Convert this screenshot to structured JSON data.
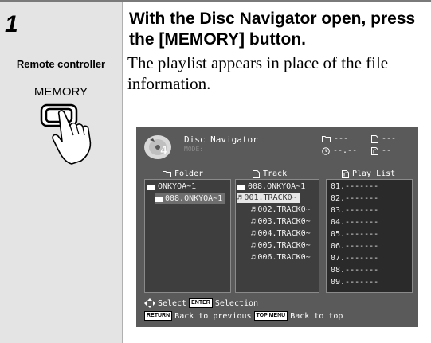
{
  "step": {
    "number": "1"
  },
  "sidebar": {
    "remote_label": "Remote controller",
    "button_label": "MEMORY"
  },
  "instruction": {
    "heading": "With the Disc Navigator open, press the [MEMORY] button.",
    "body": "The playlist appears in place of the file information."
  },
  "screen": {
    "disc_number": "4",
    "title": "Disc Navigator",
    "mode": "MODE:",
    "status": [
      "---",
      "---",
      "--.--",
      "--"
    ],
    "folder_pane": {
      "header": "Folder",
      "items": [
        "ONKYOA~1",
        "008.ONKYOA~1"
      ]
    },
    "track_pane": {
      "header": "Track",
      "items": [
        "008.ONKYOA~1",
        "001.TRACK0~",
        "002.TRACK0~",
        "003.TRACK0~",
        "004.TRACK0~",
        "005.TRACK0~",
        "006.TRACK0~"
      ]
    },
    "playlist_pane": {
      "header": "Play List",
      "items": [
        "01.-------",
        "02.-------",
        "03.-------",
        "04.-------",
        "05.-------",
        "06.-------",
        "07.-------",
        "08.-------",
        "09.-------"
      ]
    },
    "footer": {
      "select_label": "Select",
      "enter_key": "ENTER",
      "selection_label": "Selection",
      "return_key": "RETURN",
      "back_previous": "Back to previous",
      "topmenu_key": "TOP MENU",
      "back_top": "Back to top"
    }
  }
}
